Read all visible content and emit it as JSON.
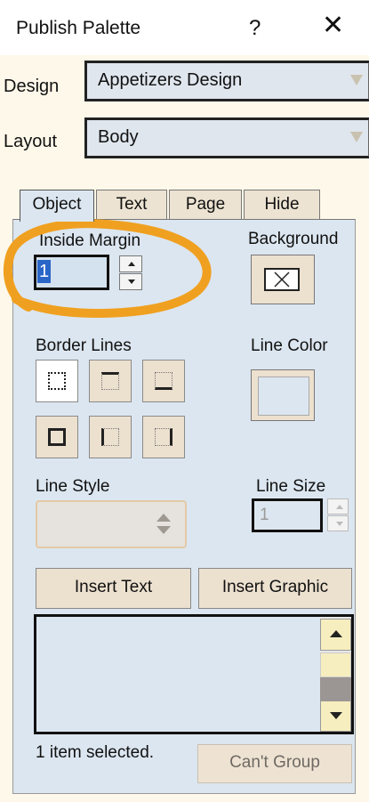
{
  "window": {
    "title": "Publish Palette",
    "help_symbol": "?",
    "close_symbol": "✕"
  },
  "design": {
    "label": "Design",
    "value": "Appetizers Design"
  },
  "layout": {
    "label": "Layout",
    "value": "Body"
  },
  "tabs": [
    {
      "label": "Object",
      "active": true
    },
    {
      "label": "Text",
      "active": false
    },
    {
      "label": "Page",
      "active": false
    },
    {
      "label": "Hide",
      "active": false
    }
  ],
  "object_panel": {
    "inside_margin_label": "Inside Margin",
    "inside_margin_value": "1",
    "background_label": "Background",
    "border_lines_label": "Border Lines",
    "line_color_label": "Line Color",
    "line_style_label": "Line Style",
    "line_size_label": "Line Size",
    "line_size_value": "1",
    "insert_text_label": "Insert Text",
    "insert_graphic_label": "Insert Graphic",
    "status_text": "1 item selected.",
    "group_button_label": "Can't Group"
  },
  "colors": {
    "panel_bg": "#dce6f0",
    "window_bg": "#fdf8e9",
    "highlight_annotation": "#f0a020",
    "button_bg": "#ece0cf"
  }
}
